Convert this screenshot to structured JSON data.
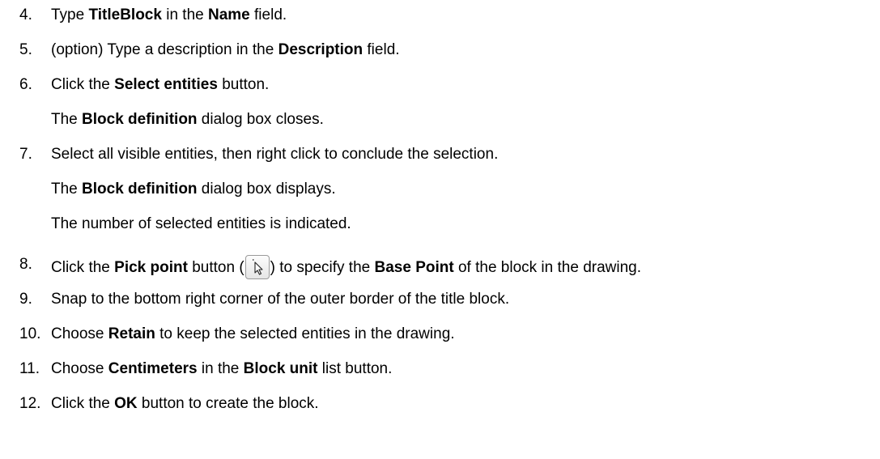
{
  "steps": [
    {
      "num": "4.",
      "parts": [
        "Type ",
        "TitleBlock",
        " in the ",
        "Name",
        " field."
      ]
    },
    {
      "num": "5.",
      "parts": [
        "(option) Type a description in the ",
        "Description",
        " field."
      ]
    },
    {
      "num": "6.",
      "parts": [
        "Click the ",
        "Select entities",
        " button."
      ]
    },
    {
      "note": [
        "The ",
        "Block definition",
        " dialog box closes."
      ]
    },
    {
      "num": "7.",
      "parts": [
        "Select all visible entities, then right click to conclude the selection."
      ]
    },
    {
      "note": [
        "The ",
        "Block definition",
        " dialog box displays."
      ]
    },
    {
      "note": [
        "The number of selected entities is indicated."
      ]
    },
    {
      "num": "8.",
      "parts": [
        "Click the ",
        "Pick point",
        " button (",
        ") to specify the ",
        "Base Point",
        " of the block in the drawing."
      ]
    },
    {
      "num": "9.",
      "parts": [
        "Snap to the bottom right corner of the outer border of the title block."
      ]
    },
    {
      "num": "10.",
      "parts": [
        "Choose ",
        "Retain",
        " to keep the selected entities in the drawing."
      ]
    },
    {
      "num": "11.",
      "parts": [
        "Choose ",
        "Centimeters",
        " in the ",
        "Block unit",
        " list button."
      ]
    },
    {
      "num": "12.",
      "parts": [
        "Click the ",
        "OK",
        " button to create the block."
      ]
    }
  ],
  "icons": {
    "pick_point": "pick-point-cursor-icon"
  }
}
